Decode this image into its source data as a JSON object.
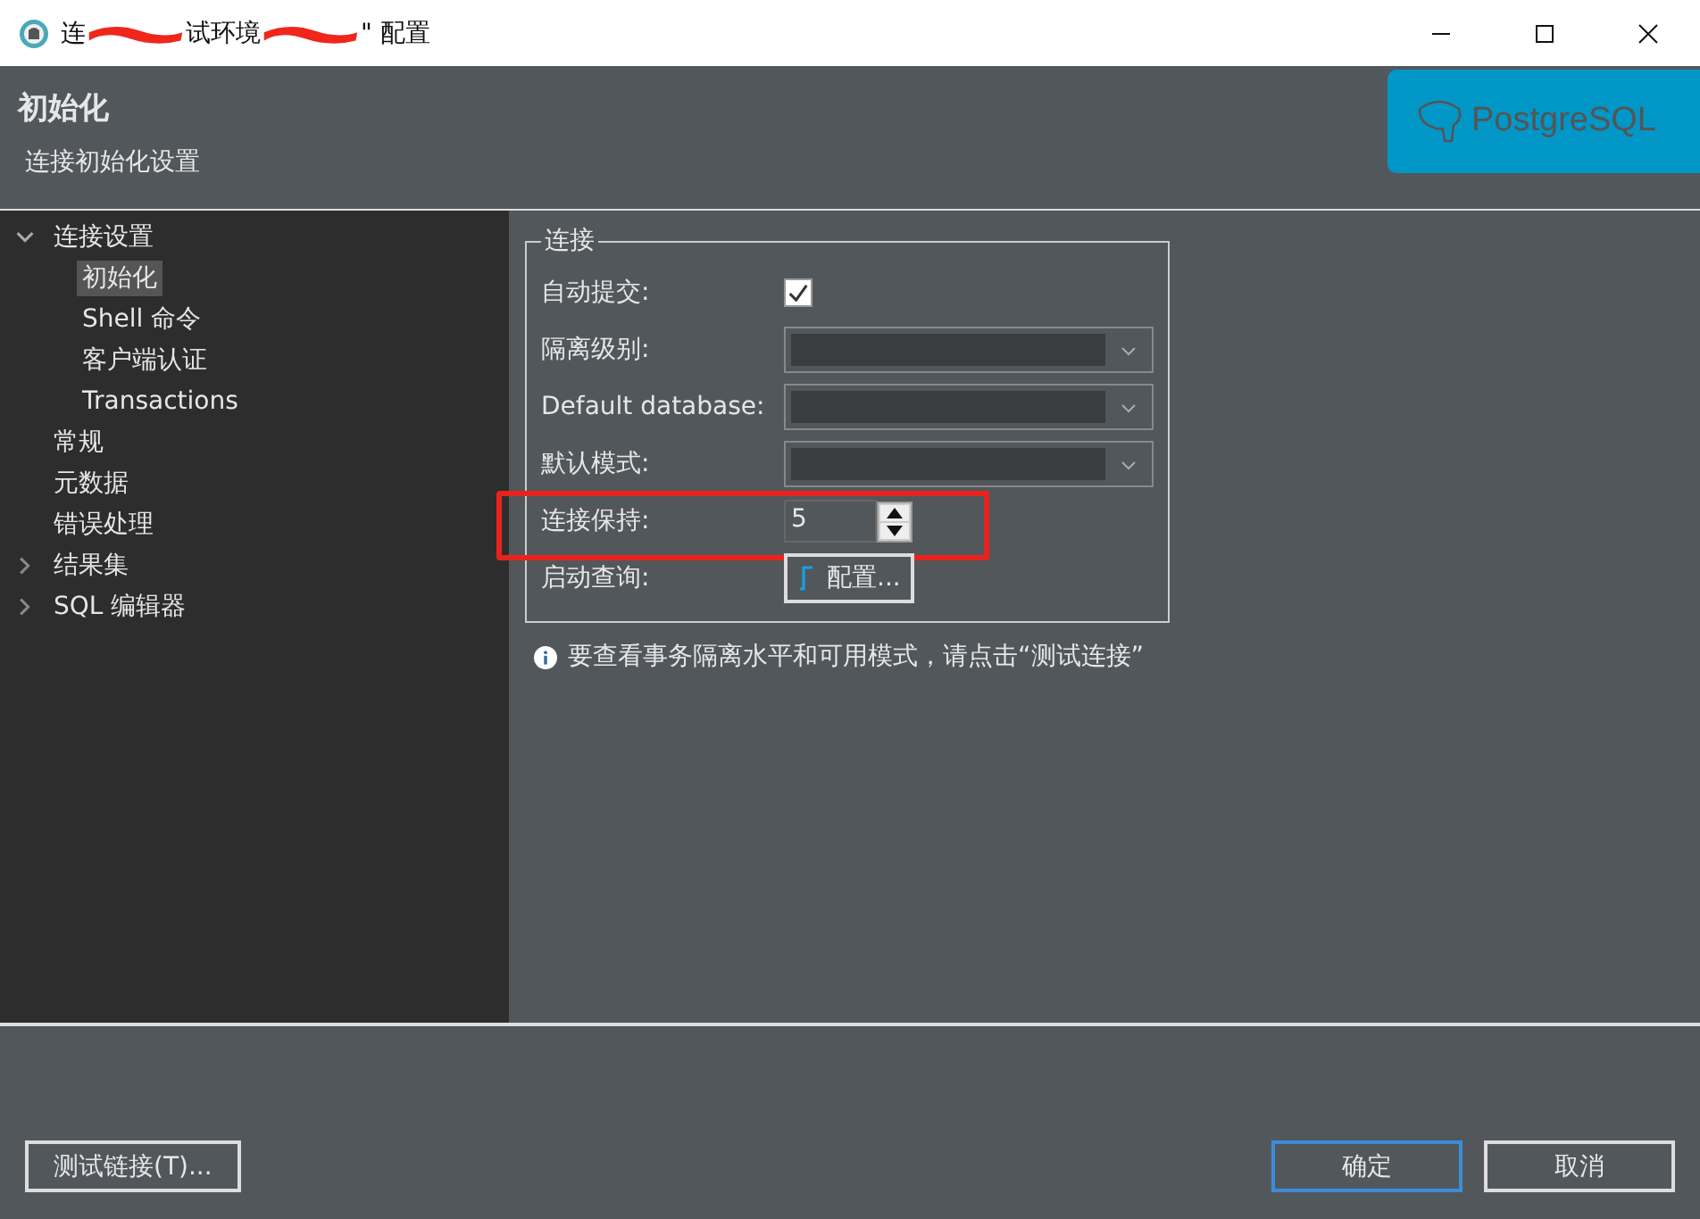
{
  "window": {
    "title_parts": [
      "连",
      "试环境",
      "\" 配置"
    ]
  },
  "header": {
    "title": "初始化",
    "subtitle": "连接初始化设置",
    "logo_text": "PostgreSQL"
  },
  "sidebar": {
    "items": [
      {
        "label": "连接设置",
        "expanded": true,
        "selected": false,
        "children": [
          {
            "label": "初始化",
            "selected": true
          },
          {
            "label": "Shell 命令",
            "selected": false
          },
          {
            "label": "客户端认证",
            "selected": false
          },
          {
            "label": "Transactions",
            "selected": false
          }
        ]
      },
      {
        "label": "常规",
        "selected": false
      },
      {
        "label": "元数据",
        "selected": false
      },
      {
        "label": "错误处理",
        "selected": false
      },
      {
        "label": "结果集",
        "expanded": false,
        "selected": false
      },
      {
        "label": "SQL 编辑器",
        "expanded": false,
        "selected": false
      }
    ]
  },
  "group": {
    "title": "连接",
    "rows": [
      {
        "kind": "checkbox",
        "label": "自动提交:",
        "checked": true
      },
      {
        "kind": "combo",
        "label": "隔离级别:"
      },
      {
        "kind": "combo",
        "label": "Default database:"
      },
      {
        "kind": "combo",
        "label": "默认模式:"
      },
      {
        "kind": "spinner",
        "label": "连接保持:",
        "value": "5",
        "highlighted": true
      },
      {
        "kind": "button",
        "label": "启动查询:",
        "button": "配置..."
      }
    ]
  },
  "info": "要查看事务隔离水平和可用模式，请点击“测试连接”",
  "buttons": {
    "test": "测试链接(T)...",
    "ok": "确定",
    "cancel": "取消"
  }
}
